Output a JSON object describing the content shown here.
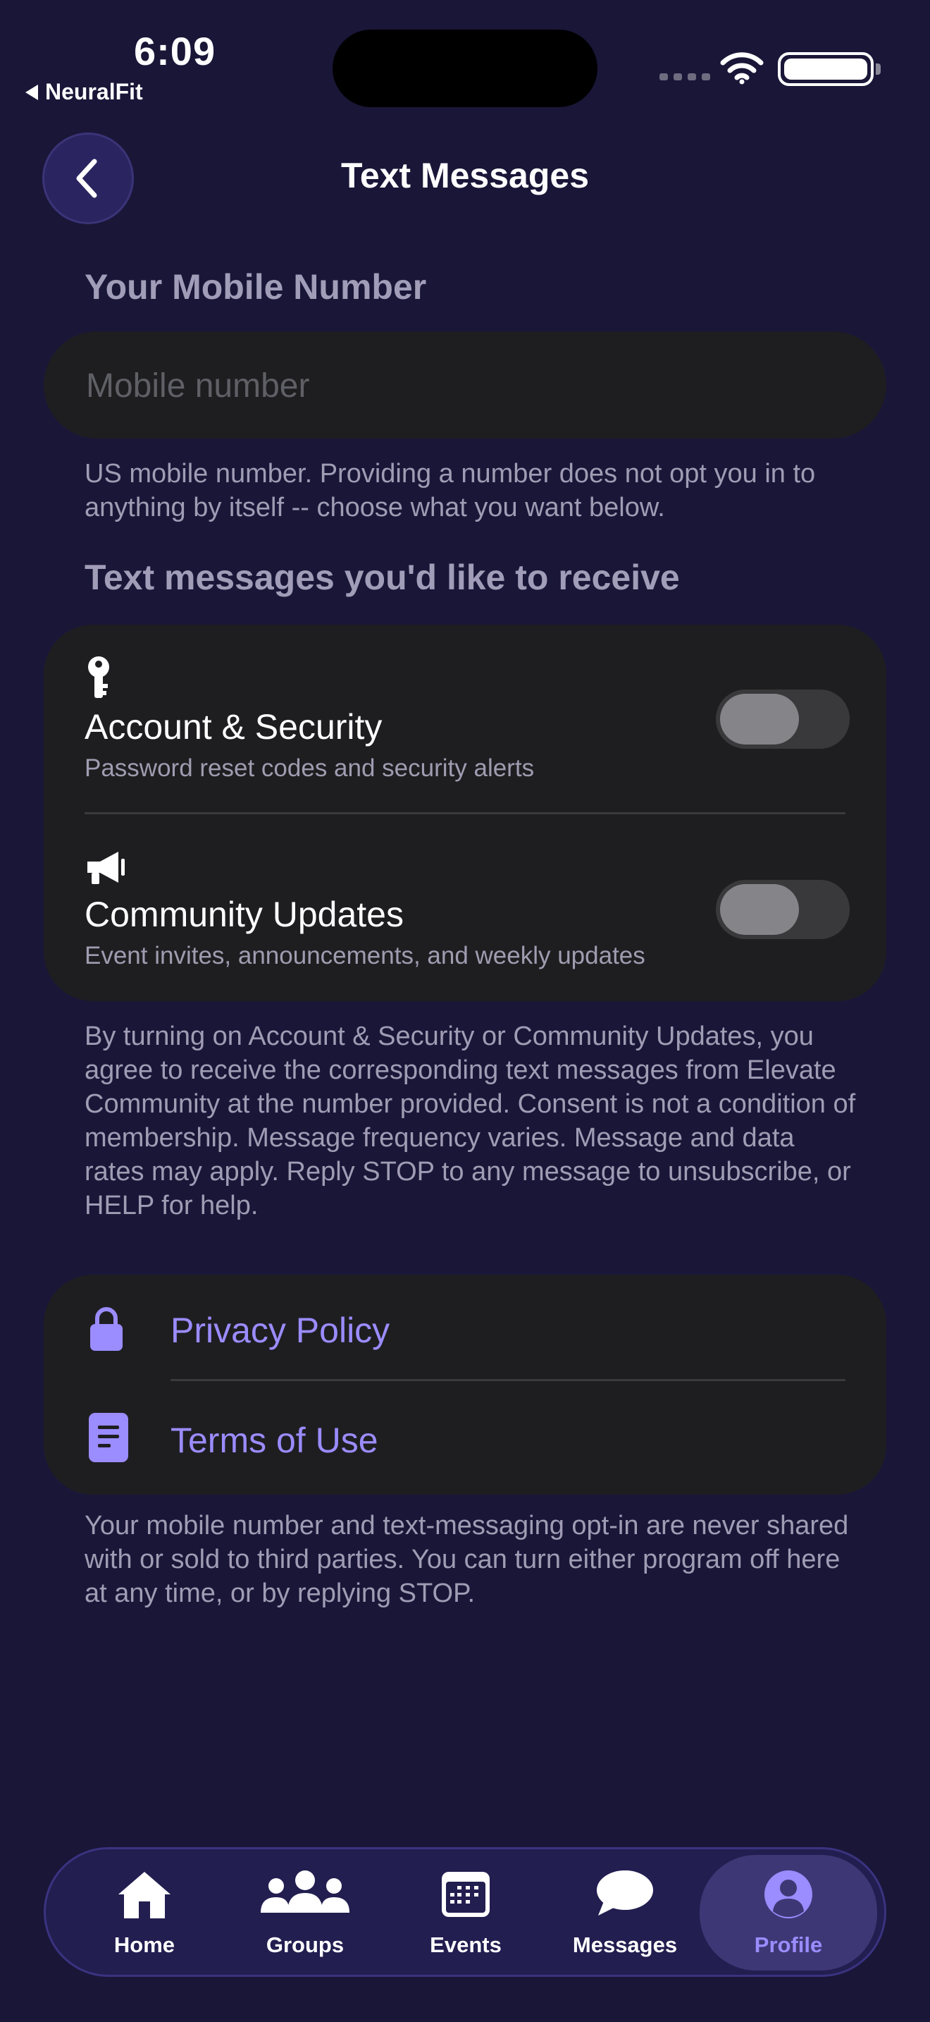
{
  "status_bar": {
    "time": "6:09",
    "back_app": "NeuralFit"
  },
  "header": {
    "title": "Text Messages"
  },
  "mobile": {
    "section_title": "Your Mobile Number",
    "placeholder": "Mobile number",
    "value": "",
    "help": "US mobile number. Providing a number does not opt you in to anything by itself -- choose what you want below."
  },
  "preferences": {
    "section_title": "Text messages you'd like to receive",
    "items": [
      {
        "title": "Account & Security",
        "subtitle": "Password reset codes and security alerts",
        "enabled": false,
        "icon": "key-icon"
      },
      {
        "title": "Community Updates",
        "subtitle": "Event invites, announcements, and weekly updates",
        "enabled": false,
        "icon": "megaphone-icon"
      }
    ],
    "consent": "By turning on Account & Security or Community Updates, you agree to receive the corresponding text messages from Elevate Community at the number provided. Consent is not a condition of membership. Message frequency varies. Message and data rates may apply. Reply STOP to any message to unsubscribe, or HELP for help."
  },
  "links": {
    "items": [
      {
        "label": "Privacy Policy",
        "icon": "lock-icon"
      },
      {
        "label": "Terms of Use",
        "icon": "document-icon"
      }
    ],
    "privacy_note": "Your mobile number and text-messaging opt-in are never shared with or sold to third parties. You can turn either program off here at any time, or by replying STOP."
  },
  "tabbar": {
    "items": [
      {
        "label": "Home",
        "icon": "home-icon"
      },
      {
        "label": "Groups",
        "icon": "groups-icon"
      },
      {
        "label": "Events",
        "icon": "calendar-icon"
      },
      {
        "label": "Messages",
        "icon": "chat-bubble-icon"
      },
      {
        "label": "Profile",
        "icon": "profile-icon",
        "active": true
      }
    ]
  },
  "colors": {
    "background": "#1a1638",
    "card": "#1e1e21",
    "accent": "#9b8cff",
    "tabbar": "#221e50"
  }
}
